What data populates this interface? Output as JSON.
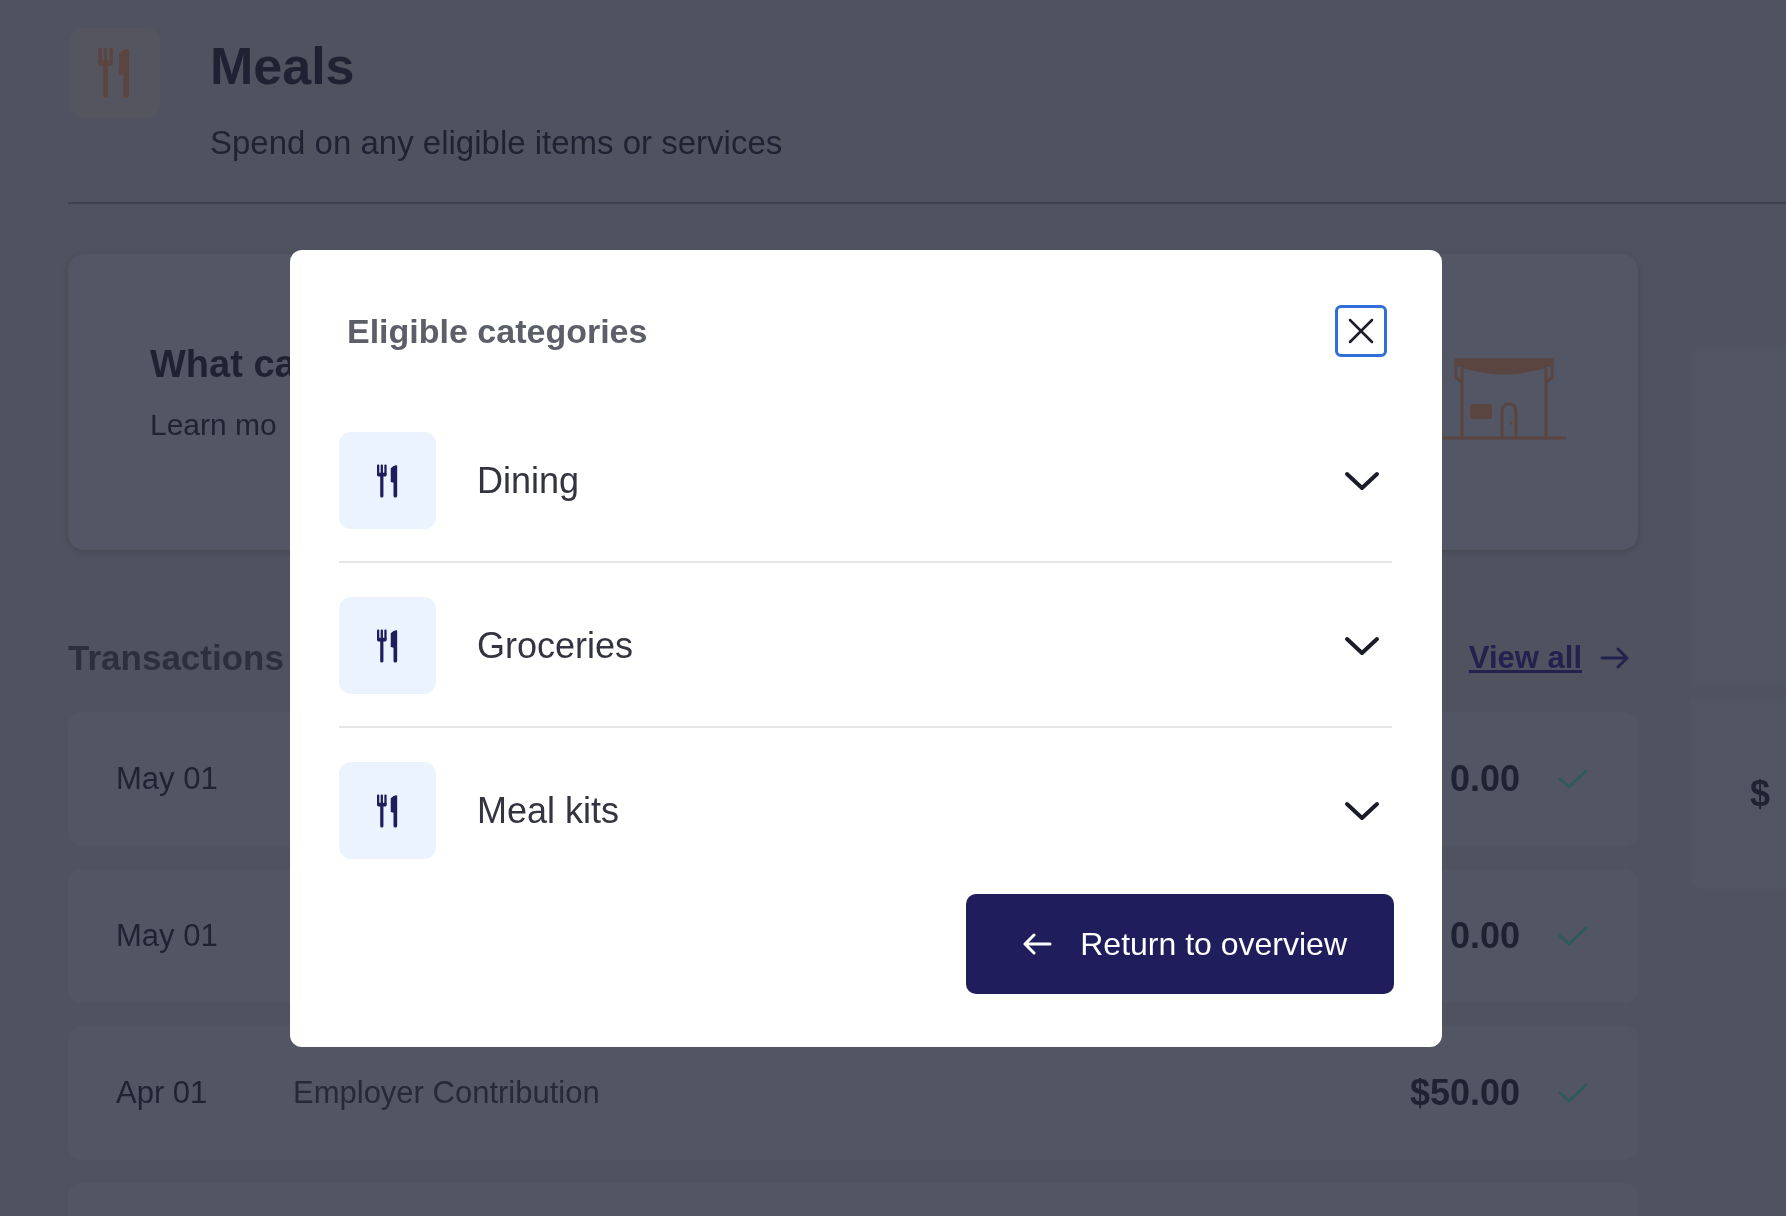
{
  "page": {
    "title": "Meals",
    "subtitle": "Spend on any eligible items or services",
    "info_card": {
      "title": "What ca",
      "text": "Learn mo"
    },
    "transactions": {
      "heading": "Transactions",
      "view_all": "View all",
      "rows": [
        {
          "date": "May 01",
          "amount": "0.00"
        },
        {
          "date": "May 01",
          "amount": "0.00"
        },
        {
          "date": "Apr 01",
          "description": "Employer Contribution",
          "amount": "$50.00"
        }
      ]
    },
    "side_panel": {
      "text": "$"
    }
  },
  "modal": {
    "title": "Eligible categories",
    "categories": [
      {
        "label": "Dining",
        "expanded": false
      },
      {
        "label": "Groceries",
        "expanded": false
      },
      {
        "label": "Meal kits",
        "expanded": false
      }
    ],
    "button": "Return to overview"
  }
}
